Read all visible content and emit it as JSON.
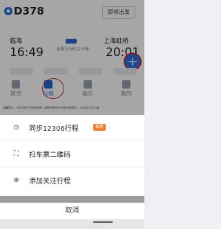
{
  "header": {
    "train_number": "D378",
    "train_logo": "train-logo-icon",
    "soon_badge": "即将出发"
  },
  "route": {
    "departure_station": "临海",
    "departure_time": "16:49",
    "arrival_station": "上海虹桥",
    "arrival_time": "20:01",
    "duration": "全程3小时12分钟"
  },
  "fab": {
    "icon": "plus-icon"
  },
  "tabbar": [
    {
      "label": "首页",
      "icon": "home-icon"
    },
    {
      "label": "行程",
      "icon": "trip-icon"
    },
    {
      "label": "娱乐",
      "icon": "entertainment-icon"
    },
    {
      "label": "我的",
      "icon": "profile-icon"
    }
  ],
  "notice": "温馨提示：本次列车已开始检票，请携带有效证件前往检票口，以车站公告为准",
  "sheet": {
    "items": [
      {
        "label": "同步12306行程",
        "icon": "sync-icon",
        "badge": "推荐"
      },
      {
        "label": "扫车票二维码",
        "icon": "scan-icon"
      },
      {
        "label": "添加关注行程",
        "icon": "add-circle-icon"
      }
    ],
    "cancel": "取消"
  },
  "colors": {
    "accent": "#1f6ad8",
    "highlight_ring": "#d92525",
    "badge": "#f47a2a"
  }
}
